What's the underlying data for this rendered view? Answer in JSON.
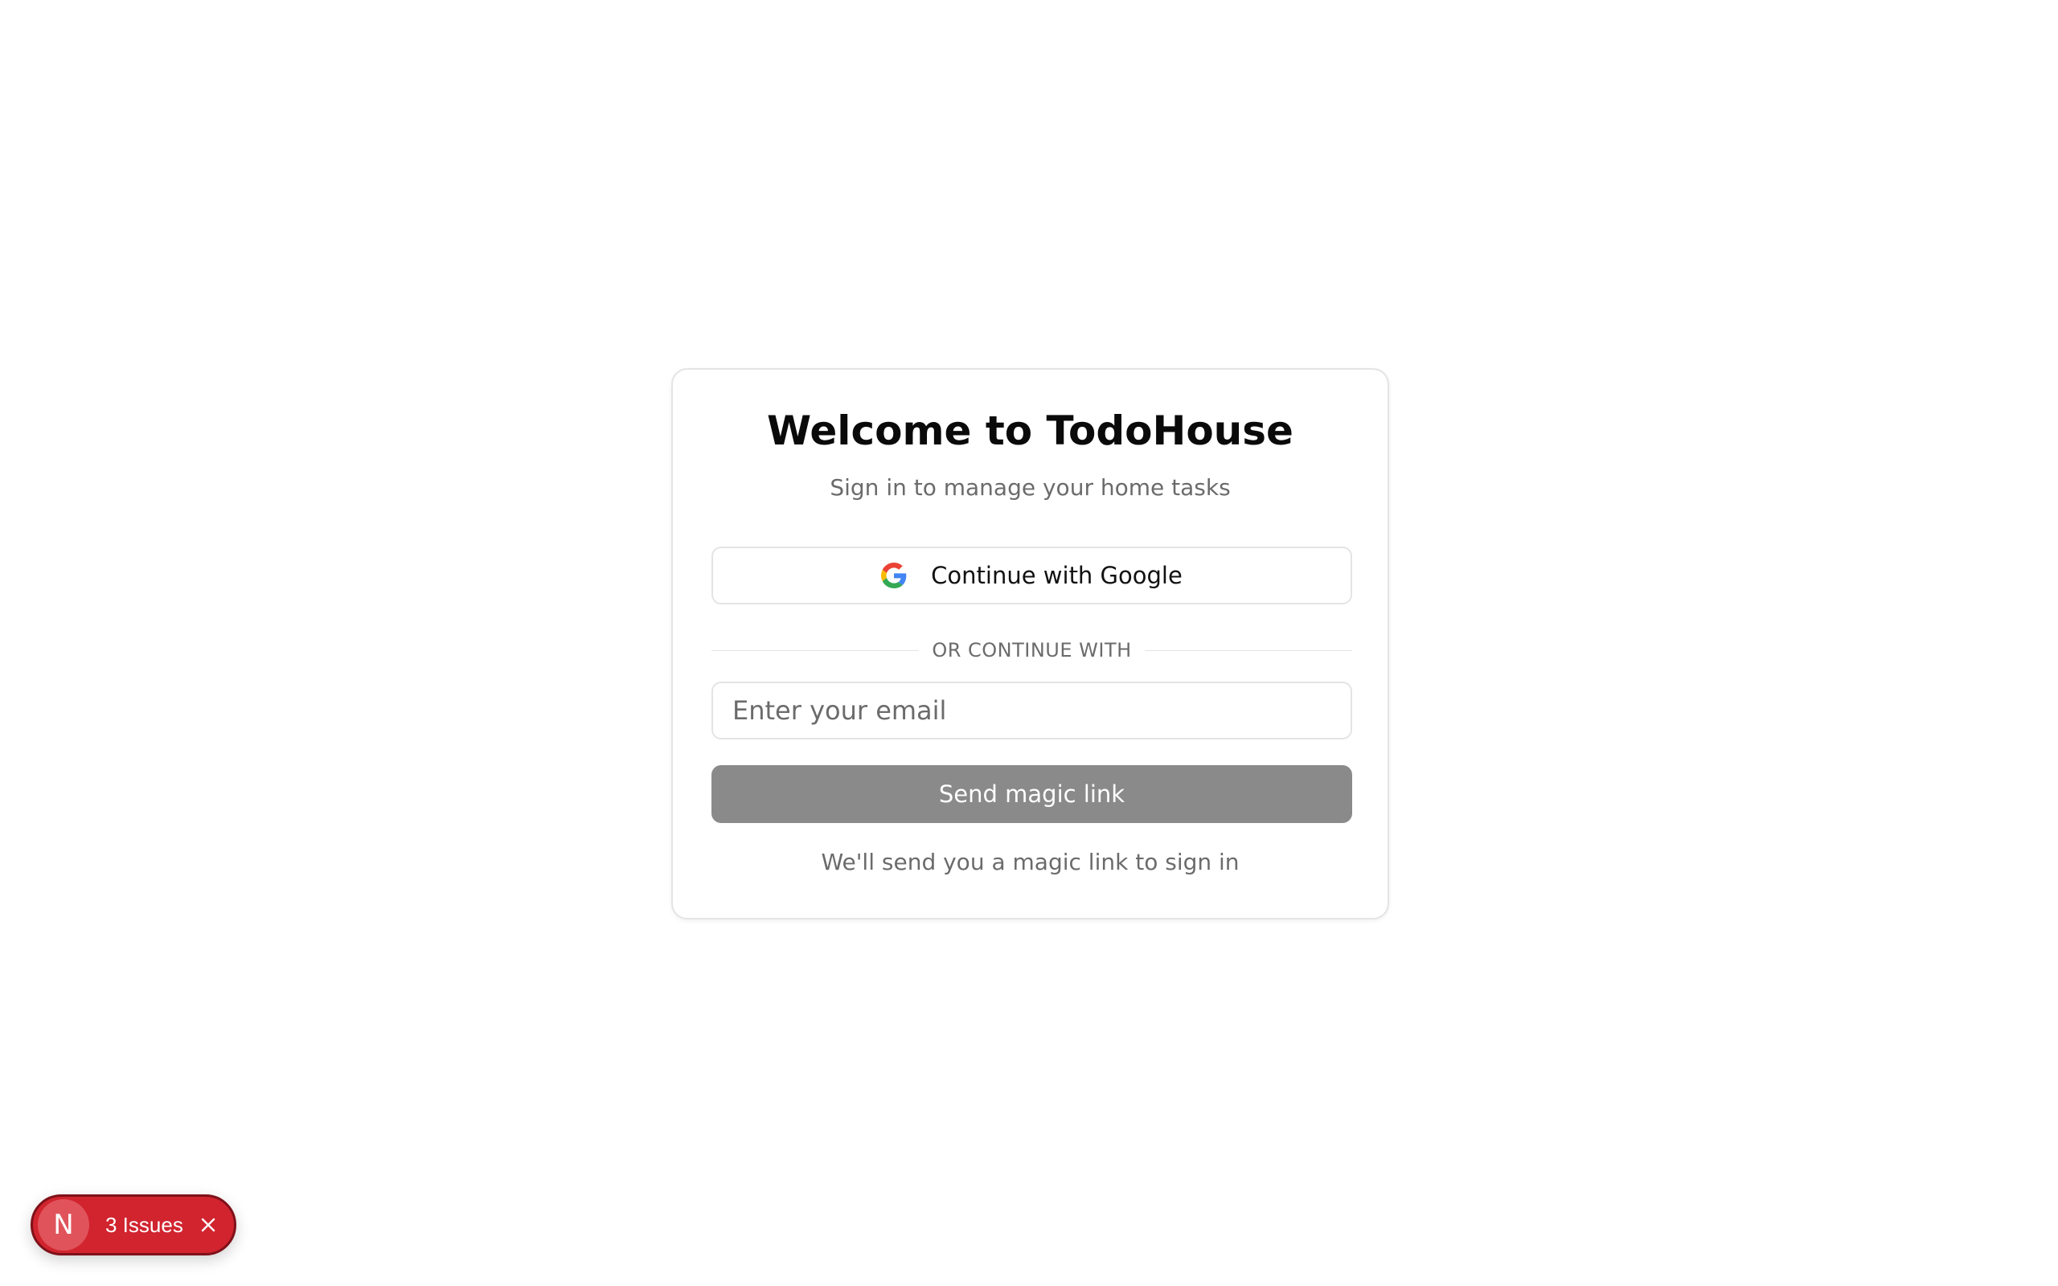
{
  "login": {
    "title": "Welcome to TodoHouse",
    "subtitle": "Sign in to manage your home tasks",
    "google_button_label": "Continue with Google",
    "google_icon": "google-g-icon",
    "divider_text": "OR CONTINUE WITH",
    "email_placeholder": "Enter your email",
    "email_value": "",
    "send_button_label": "Send magic link",
    "hint": "We'll send you a magic link to sign in"
  },
  "dev_overlay": {
    "badge_letter": "N",
    "issues_label": "3 Issues",
    "close_icon": "close-icon"
  },
  "colors": {
    "send_button_disabled": "#8a8a8a",
    "issues_pill": "#d1242f",
    "muted_text": "#6b6b6b",
    "border": "#e4e4e7"
  }
}
